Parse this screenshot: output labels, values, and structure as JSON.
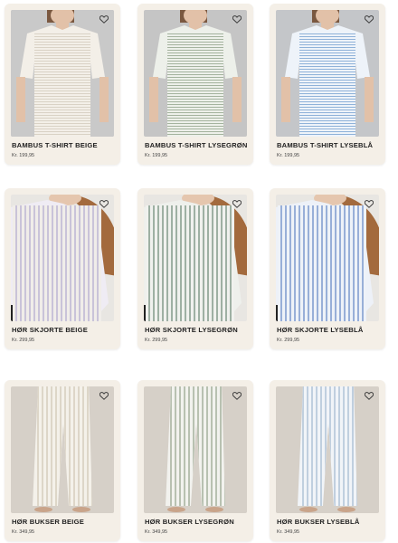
{
  "products": [
    {
      "title": "BAMBUS T-SHIRT BEIGE",
      "price": "Kr. 199,95",
      "category": "tshirt",
      "color": "#d9d2c5"
    },
    {
      "title": "BAMBUS T-SHIRT LYSEGRØN",
      "price": "Kr. 199,95",
      "category": "tshirt",
      "color": "#a4b39e"
    },
    {
      "title": "BAMBUS T-SHIRT LYSEBLÅ",
      "price": "Kr. 199,95",
      "category": "tshirt",
      "color": "#8fb2d9"
    },
    {
      "title": "HØR SKJORTE BEIGE",
      "price": "Kr. 299,95",
      "category": "shirt",
      "color": "#c9c3d9"
    },
    {
      "title": "HØR SKJORTE LYSEGRØN",
      "price": "Kr. 299,95",
      "category": "shirt",
      "color": "#9eb0a3"
    },
    {
      "title": "HØR SKJORTE LYSEBLÅ",
      "price": "Kr. 299,95",
      "category": "shirt",
      "color": "#98afd8"
    },
    {
      "title": "HØR BUKSER BEIGE",
      "price": "Kr. 349,95",
      "category": "pants",
      "color": "#ddd6c8"
    },
    {
      "title": "HØR BUKSER LYSEGRØN",
      "price": "Kr. 349,95",
      "category": "pants",
      "color": "#b8c1b1"
    },
    {
      "title": "HØR BUKSER LYSEBLÅ",
      "price": "Kr. 349,95",
      "category": "pants",
      "color": "#c0cfdf"
    }
  ],
  "icons": {
    "favorite": "heart-icon"
  }
}
